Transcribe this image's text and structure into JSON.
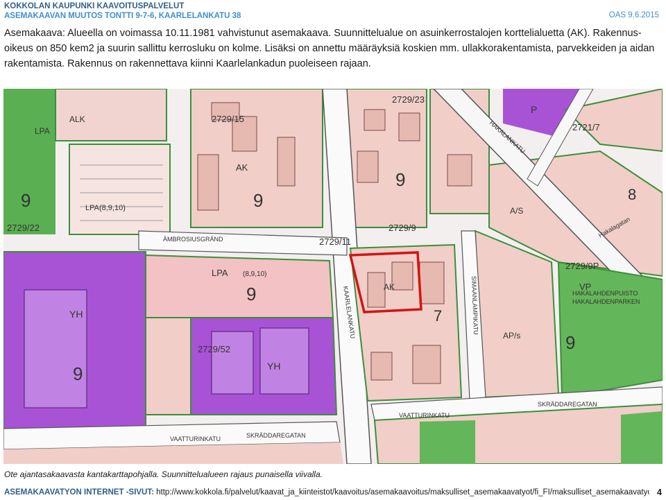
{
  "header": {
    "org": "KOKKOLAN KAUPUNKI KAAVOITUSPALVELUT",
    "project": "ASEMAKAAVAN MUUTOS TONTTI 9-7-6, KAARLELANKATU 38",
    "date": "OAS 9.6.2015"
  },
  "body": {
    "paragraph": "Asemakaava: Alueella on voimassa 10.11.1981 vahvistunut asemakaava. Suunnittelualue on  asuinkerrostalojen korttelialuetta (AK). Rakennus-oikeus on 850 kem2 ja suurin sallittu kerrosluku on kolme. Lisäksi on annettu määräyksiä koskien mm. ullakkorakentamista, parvekkeiden ja aidan rakentamista. Rakennus on rakennettava kiinni Kaarlelankadun puoleiseen rajaan."
  },
  "map": {
    "labels": {
      "lpa1": "LPA(8,9,10)",
      "lpa2": "LPA",
      "lpa2b": "(8,9,10)",
      "yh1": "YH",
      "yh2": "YH",
      "ak": "AK",
      "ak2": "AK",
      "ap": "A/S",
      "apu": "AP/s",
      "vp": "VP",
      "p": "P",
      "alk": "ALK",
      "lpa3": "LPA",
      "n9a": "9",
      "n9b": "9",
      "n9c": "9",
      "n9d": "9",
      "n9e": "9",
      "n9f": "9",
      "n7": "7",
      "n8": "8",
      "b2729_22": "2729/22",
      "b2729_15": "2729/15",
      "b2729_23": "2729/23",
      "b2729_52": "2729/52",
      "b2729_11": "2729/11",
      "b2729_9": "2729/9",
      "b2729_9p": "2729/9P",
      "b2721_7": "2721/7",
      "s_ambrosinrinne": "ÄMBROSIUSGRÄND",
      "s_vaasatie": "VAATTURINKATU",
      "s_vaasatie2": "VAATTURINKATU",
      "s_skradd": "SKRÄDDAREGATAN",
      "s_skradd2": "SKRÄDDAREGATAN",
      "s_kaarle": "KAARLELANKATU",
      "s_hakala": "HAKALANKATU",
      "s_hakala2": "Hakalagatan",
      "s_sali": "SIMAANLAMPIKATU",
      "s_puisto": "HAKALAHDENPUISTO",
      "s_parken": "HAKALAHDENPARKEN"
    }
  },
  "caption": "Ote ajantasakaavasta kantakarttapohjalla. Suunnittelualueen rajaus punaisella viivalla.",
  "footer": {
    "label": "ASEMAKAAVATYÖN INTERNET -SIVUT:",
    "url": " http://www.kokkola.fi/palvelut/kaavat_ja_kiinteistot/kaavoitus/asemakaavoitus/maksulliset_asemakaavatyot/fi_FI/maksulliset_asemakaavatyot/",
    "page_number": "4"
  },
  "colors": {
    "header_dark": "#2f5f8a",
    "header_light": "#3f8fcf",
    "residential": "#f0c9c3",
    "public": "#a64fd4",
    "park": "#4caa4c",
    "boundary": "#d11414"
  }
}
